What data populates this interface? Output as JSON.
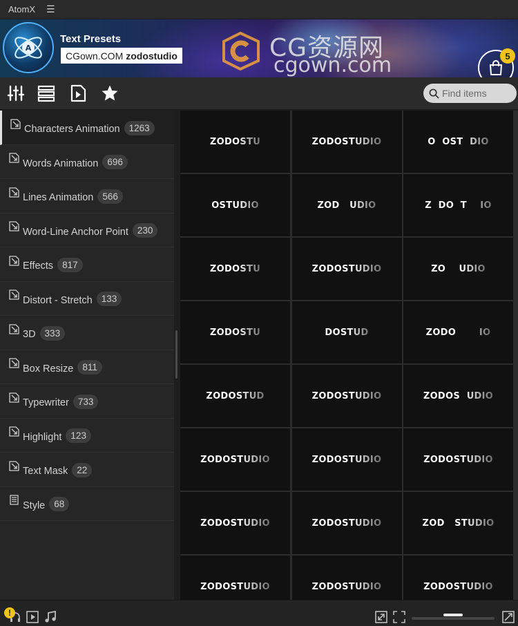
{
  "window": {
    "title": "AtomX"
  },
  "banner": {
    "title": "Text Presets",
    "box_brand": "CGown.COM",
    "box_strong": "zodostudio",
    "watermark_cn": "CG资源网",
    "watermark_url": "cgown.com",
    "cart_count": "5"
  },
  "search": {
    "placeholder": "Find items"
  },
  "categories": [
    {
      "label": "Characters Animation",
      "count": "1263"
    },
    {
      "label": "Words Animation",
      "count": "696"
    },
    {
      "label": "Lines Animation",
      "count": "566"
    },
    {
      "label": "Word-Line Anchor Point",
      "count": "230"
    },
    {
      "label": "Effects",
      "count": "817"
    },
    {
      "label": "Distort - Stretch",
      "count": "133"
    },
    {
      "label": "3D",
      "count": "333"
    },
    {
      "label": "Box Resize",
      "count": "811"
    },
    {
      "label": "Typewriter",
      "count": "733"
    },
    {
      "label": "Highlight",
      "count": "123"
    },
    {
      "label": "Text Mask",
      "count": "22"
    },
    {
      "label": "Style",
      "count": "68"
    }
  ],
  "tiles": [
    [
      "ZODOSTU",
      "ZODOSTUDIO",
      "O  OST  DIO"
    ],
    [
      "OSTUDIO",
      "ZOD   UDIO",
      "Z  DO  T    IO"
    ],
    [
      "ZODOSTU",
      "ZODOSTUDIO",
      "ZO    UDIO"
    ],
    [
      "ZODOSTU",
      "DOSTUD",
      "ZODO       IO"
    ],
    [
      "ZODOSTUD",
      "ZODOSTUDIO",
      "ZODOS  UDIO"
    ],
    [
      "ZODOSTUDIO",
      "ZODOSTUDIO",
      "ZODOSTUDIO"
    ],
    [
      "ZODOSTUDIO",
      "ZODOSTUDIO",
      "ZOD   STUDIO"
    ],
    [
      "ZODOSTUDIO",
      "ZODOSTUDIO",
      "ZODOSTUDIO"
    ]
  ],
  "colors": {
    "accent_badge": "#f0c419",
    "tile_bg": "#111111",
    "panel_bg": "#262626"
  },
  "icons": {
    "toolbar": [
      "sliders-icon",
      "list-icon",
      "preset-file-icon",
      "star-icon"
    ],
    "footer": [
      "warning-icon",
      "play-icon",
      "music-icon",
      "expand-icon",
      "fullscreen-icon",
      "thumbnail-size-icon"
    ]
  }
}
